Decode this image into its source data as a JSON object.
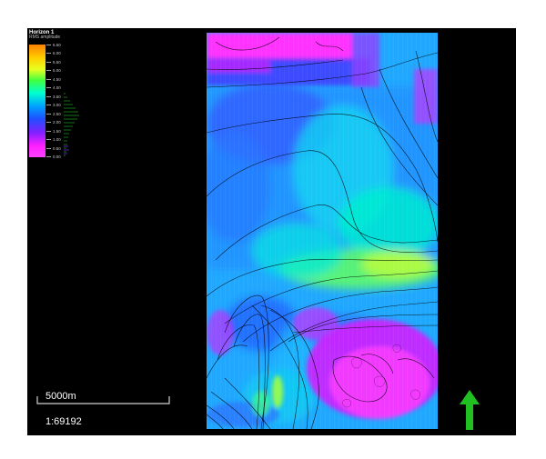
{
  "legend": {
    "title": "Horizon 1",
    "subtitle": "RMS amplitude",
    "ticks": [
      "6.50",
      "6.00",
      "5.50",
      "5.00",
      "4.50",
      "4.00",
      "3.50",
      "3.00",
      "2.50",
      "2.00",
      "1.50",
      "1.00",
      "0.50",
      "0.00"
    ]
  },
  "scale": {
    "distance_label": "5000m",
    "ratio": "1:69192"
  },
  "colors": {
    "background": "#000000",
    "north_arrow": "#20c020",
    "contour": "#000000"
  },
  "icons": {
    "north": "north-arrow-icon"
  }
}
